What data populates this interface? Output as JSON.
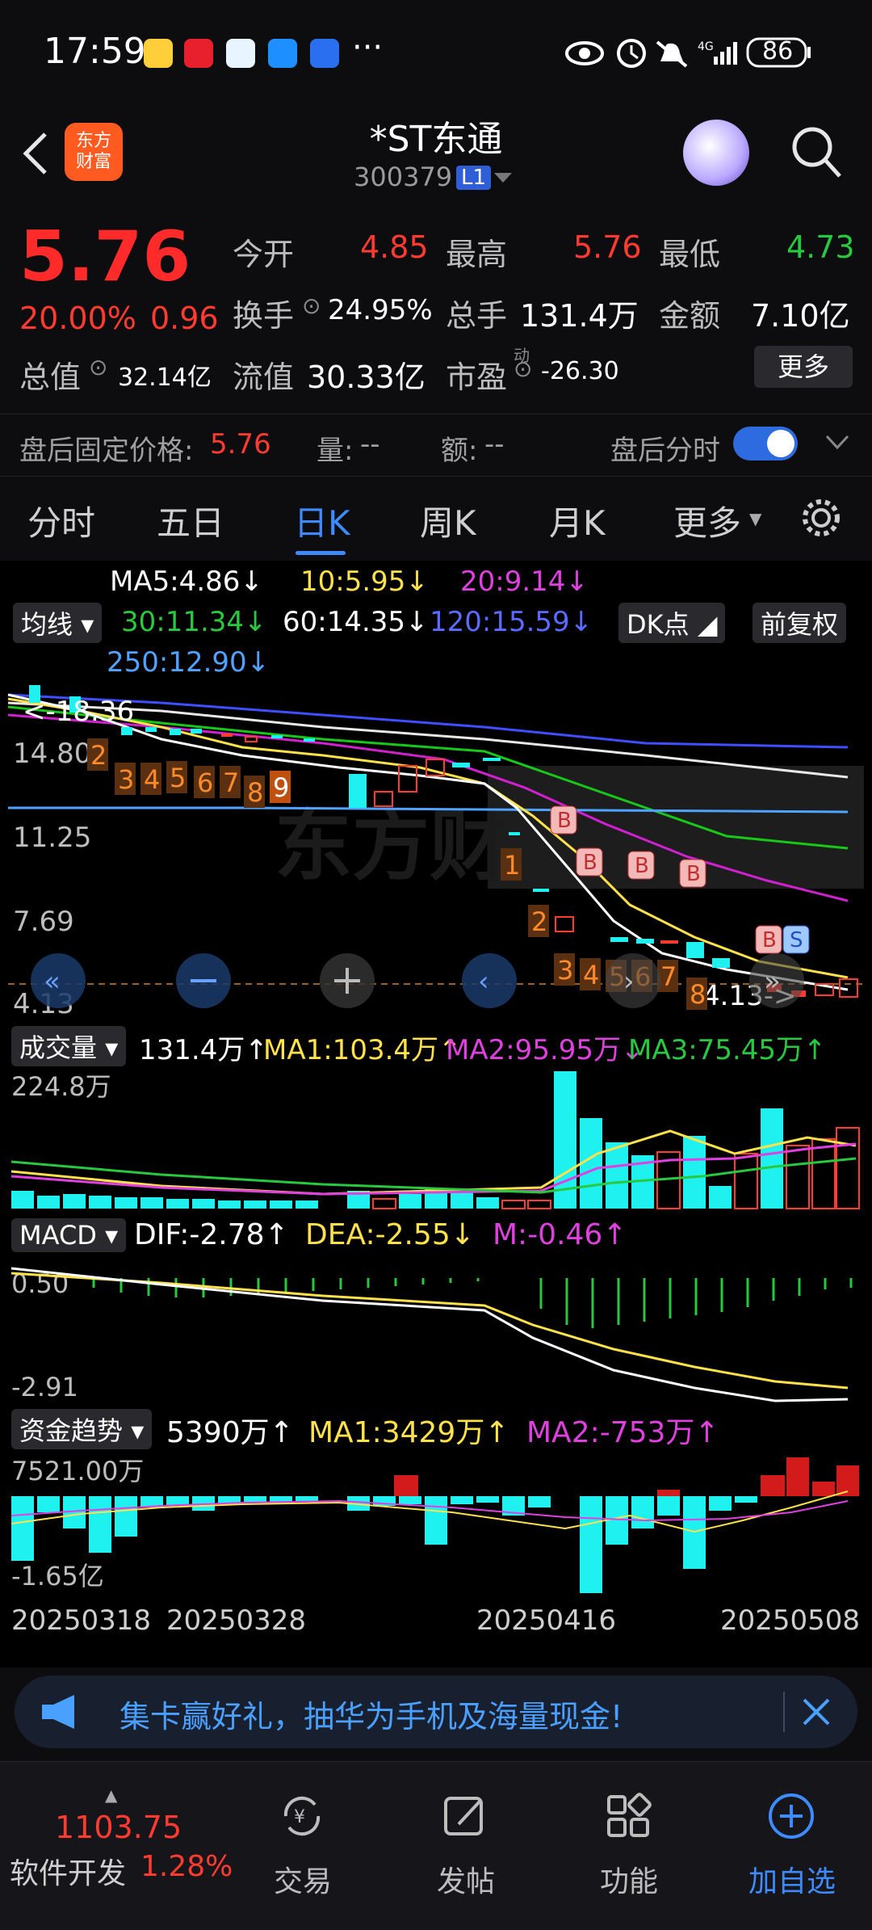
{
  "status_bar": {
    "time": "17:59",
    "network": "4G",
    "battery": "86"
  },
  "header": {
    "logo_text": "东方\n财富",
    "title": "*ST东通",
    "code": "300379",
    "level": "L1"
  },
  "quote": {
    "price": "5.76",
    "change_pct": "20.00%",
    "change": "0.96",
    "open_label": "今开",
    "open": "4.85",
    "high_label": "最高",
    "high": "5.76",
    "low_label": "最低",
    "low": "4.73",
    "turnover_label": "换手",
    "turnover": "24.95%",
    "volume_label": "总手",
    "volume": "131.4万",
    "amount_label": "金额",
    "amount": "7.10亿",
    "mktcap_label": "总值",
    "mktcap": "32.14亿",
    "float_label": "流值",
    "float_cap": "30.33亿",
    "pe_label": "市盈",
    "pe_sup": "动",
    "pe": "-26.30",
    "more_label": "更多"
  },
  "after_hours": {
    "fixed_label": "盘后固定价格:",
    "fixed_price": "5.76",
    "vol_label": "量:",
    "vol": "--",
    "amt_label": "额:",
    "amt": "--",
    "minute_label": "盘后分时"
  },
  "tabs": [
    "分时",
    "五日",
    "日K",
    "周K",
    "月K",
    "更多"
  ],
  "active_tab": "日K",
  "ma_bar": {
    "select_label": "均线",
    "ma5": "MA5:4.86↓",
    "ma10": "10:5.95↓",
    "ma20": "20:9.14↓",
    "ma30": "30:11.34↓",
    "ma60": "60:14.35↓",
    "ma120": "120:15.59↓",
    "ma250": "250:12.90↓",
    "dk_label": "DK点",
    "adjust_label": "前复权"
  },
  "kline": {
    "axis": [
      "14.80",
      "11.25",
      "7.69",
      "4.13"
    ],
    "max_marker": "<-18.36",
    "min_marker": "4.13->",
    "seq_numbers": [
      "2",
      "3",
      "4",
      "5",
      "6",
      "7",
      "8",
      "9",
      "1",
      "2",
      "3",
      "4",
      "5",
      "6",
      "7",
      "8"
    ],
    "b_marker": "B",
    "s_marker": "S",
    "watermark": "东方财"
  },
  "volume": {
    "select_label": "成交量",
    "value": "131.4万↑",
    "ma1": "MA1:103.4万↑",
    "ma2": "MA2:95.95万↓",
    "ma3": "MA3:75.45万↑",
    "axis_top": "224.8万"
  },
  "macd": {
    "select_label": "MACD",
    "dif": "DIF:-2.78↑",
    "dea": "DEA:-2.55↓",
    "m": "M:-0.46↑",
    "axis_top": "0.50",
    "axis_bottom": "-2.91"
  },
  "fund_flow": {
    "select_label": "资金趋势",
    "value": "5390万↑",
    "ma1": "MA1:3429万↑",
    "ma2": "MA2:-753万↑",
    "axis_top": "7521.00万",
    "axis_bottom": "-1.65亿"
  },
  "dates": [
    "20250318",
    "20250328",
    "20250416",
    "20250508"
  ],
  "promo": {
    "text": "集卡赢好礼，抽华为手机及海量现金!"
  },
  "bottom_nav": {
    "index_value": "1103.75",
    "index_name": "软件开发",
    "index_change": "1.28%",
    "items": [
      "交易",
      "发帖",
      "功能",
      "加自选"
    ]
  },
  "colors": {
    "up": "#ff3b30",
    "down": "#1ff0f0",
    "accent": "#3d8bff"
  }
}
